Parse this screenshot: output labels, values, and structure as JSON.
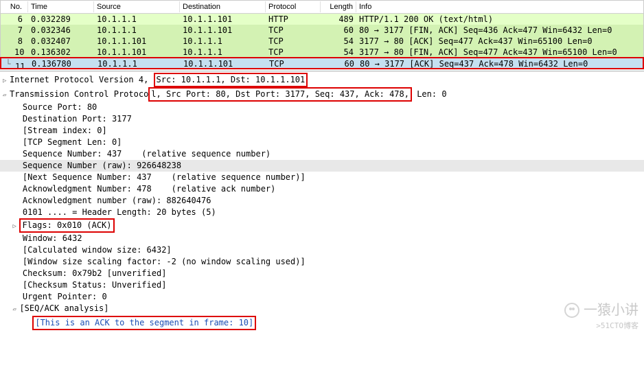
{
  "columns": {
    "no": "No.",
    "time": "Time",
    "src": "Source",
    "dst": "Destination",
    "proto": "Protocol",
    "len": "Length",
    "info": "Info"
  },
  "packets": [
    {
      "no": "6",
      "time": "0.032289",
      "src": "10.1.1.1",
      "dst": "10.1.1.101",
      "proto": "HTTP",
      "len": "489",
      "info": "HTTP/1.1 200 OK  (text/html)",
      "cls": "green"
    },
    {
      "no": "7",
      "time": "0.032346",
      "src": "10.1.1.1",
      "dst": "10.1.1.101",
      "proto": "TCP",
      "len": "60",
      "info": "80 → 3177 [FIN, ACK] Seq=436 Ack=477 Win=6432 Len=0",
      "cls": "green2"
    },
    {
      "no": "8",
      "time": "0.032407",
      "src": "10.1.1.101",
      "dst": "10.1.1.1",
      "proto": "TCP",
      "len": "54",
      "info": "3177 → 80 [ACK] Seq=477 Ack=437 Win=65100 Len=0",
      "cls": "green2"
    },
    {
      "no": "10",
      "time": "0.136302",
      "src": "10.1.1.101",
      "dst": "10.1.1.1",
      "proto": "TCP",
      "len": "54",
      "info": "3177 → 80 [FIN, ACK] Seq=477 Ack=437 Win=65100 Len=0",
      "cls": "green2"
    },
    {
      "no": "11",
      "time": "0.136780",
      "src": "10.1.1.1",
      "dst": "10.1.1.101",
      "proto": "TCP",
      "len": "60",
      "info": "80 → 3177 [ACK] Seq=437 Ack=478 Win=6432 Len=0",
      "cls": "sel"
    }
  ],
  "ip_line_prefix": "Internet Protocol Version 4, ",
  "ip_line_box": "Src: 10.1.1.1, Dst: 10.1.1.101",
  "tcp_line_prefix": "Transmission Control Protoco",
  "tcp_line_box": "l, Src Port: 80, Dst Port: 3177, Seq: 437, Ack: 478,",
  "tcp_line_suffix": " Len: 0",
  "details": {
    "src_port": "Source Port: 80",
    "dst_port": "Destination Port: 3177",
    "stream_idx": "[Stream index: 0]",
    "seglen": "[TCP Segment Len: 0]",
    "seqnum": "Sequence Number: 437    (relative sequence number)",
    "seqraw": "Sequence Number (raw): 926648238",
    "nextseq": "[Next Sequence Number: 437    (relative sequence number)]",
    "acknum": "Acknowledgment Number: 478    (relative ack number)",
    "ackraw": "Acknowledgment number (raw): 882640476",
    "hdrlen": "0101 .... = Header Length: 20 bytes (5)",
    "flags": "Flags: 0x010 (ACK)",
    "window": "Window: 6432",
    "calcwin": "[Calculated window size: 6432]",
    "winscale": "[Window size scaling factor: -2 (no window scaling used)]",
    "cksum": "Checksum: 0x79b2 [unverified]",
    "ckstat": "[Checksum Status: Unverified]",
    "urg": "Urgent Pointer: 0",
    "seqack": "[SEQ/ACK analysis]",
    "ackto": "[This is an ACK to the segment in frame: 10]"
  },
  "watermark_main": "一猿小讲",
  "watermark_sub": "51CTO博客"
}
